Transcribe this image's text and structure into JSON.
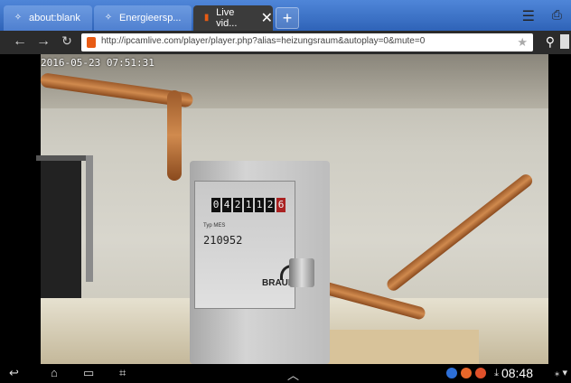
{
  "tabs": [
    {
      "label": "about:blank",
      "icon": "globe-icon",
      "active": false
    },
    {
      "label": "Energieersp...",
      "icon": "globe-icon",
      "active": false
    },
    {
      "label": "Live vid...",
      "icon": "ipcam-icon",
      "active": true
    }
  ],
  "address_bar": {
    "url": "http://ipcamlive.com/player/player.php?alias=heizungsraum&autoplay=0&mute=0"
  },
  "video": {
    "timestamp": "2016-05-23 07:51:31",
    "meter": {
      "counter_digits": [
        "0",
        "4",
        "2",
        "1",
        "1",
        "2",
        "6"
      ],
      "type_line": "Typ MES",
      "serial": "210952",
      "brand": "BRAUN"
    }
  },
  "system_bar": {
    "clock": "08:48"
  },
  "colors": {
    "tab_strip": "#3f74c8",
    "active_tab": "#3b3b3b",
    "favicon": "#e85b14"
  }
}
